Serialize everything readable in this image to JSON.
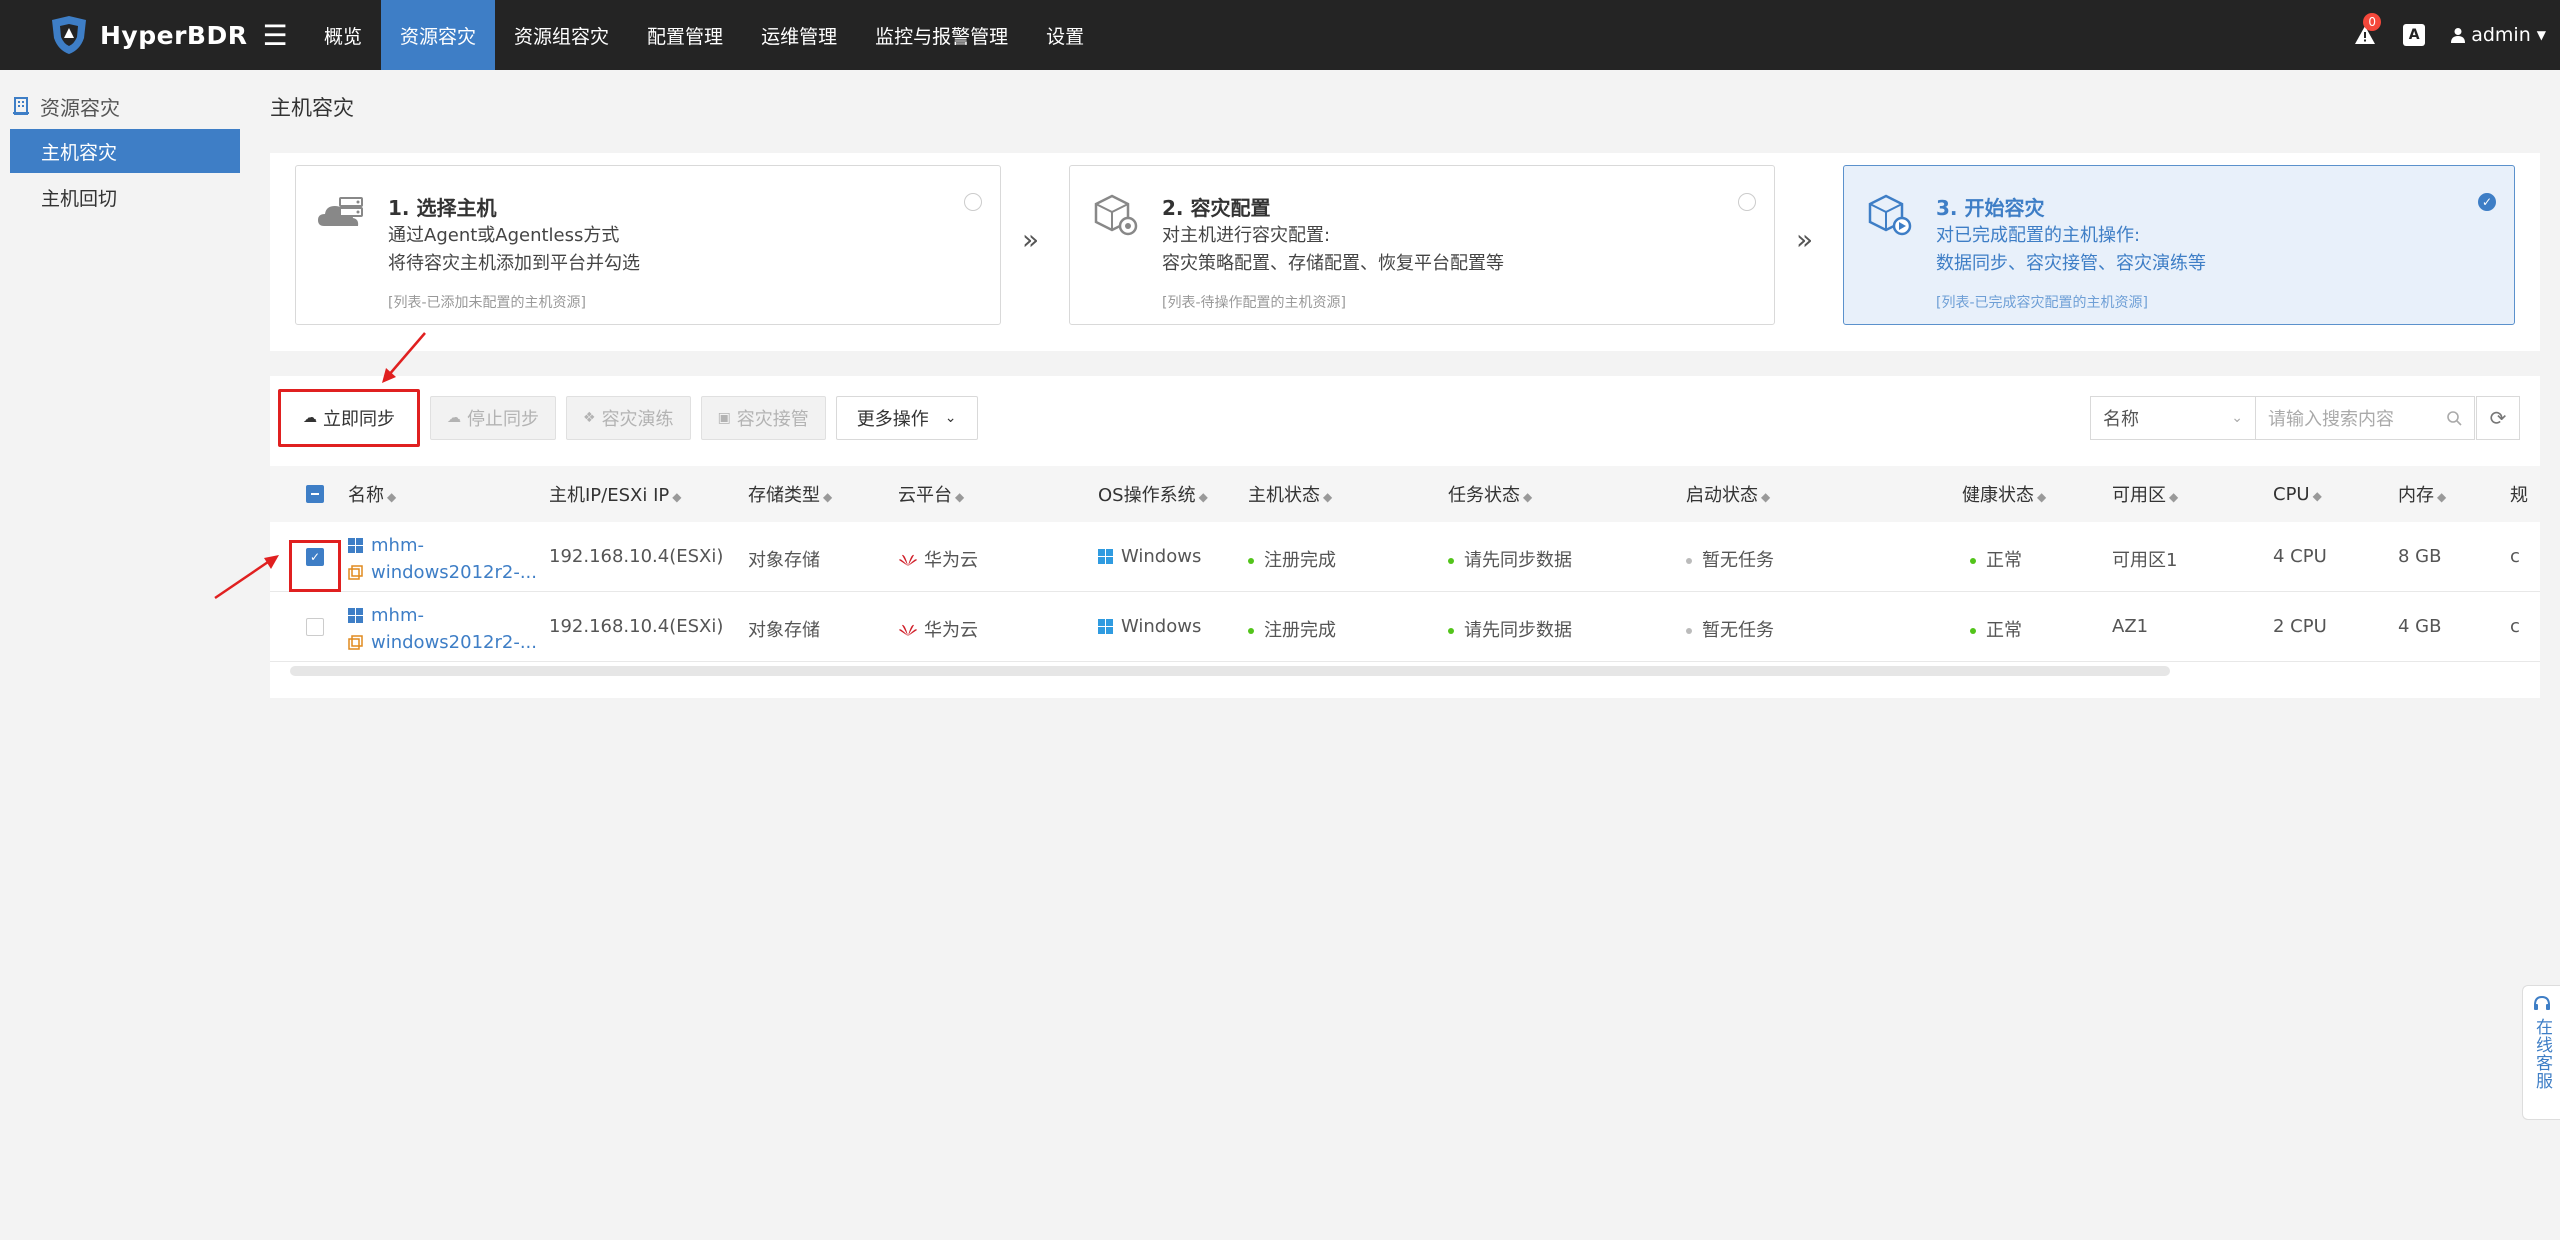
{
  "app": {
    "name": "HyperBDR"
  },
  "nav": {
    "items": [
      {
        "label": "概览",
        "active": false
      },
      {
        "label": "资源容灾",
        "active": true
      },
      {
        "label": "资源组容灾",
        "active": false
      },
      {
        "label": "配置管理",
        "active": false
      },
      {
        "label": "运维管理",
        "active": false
      },
      {
        "label": "监控与报警管理",
        "active": false
      },
      {
        "label": "设置",
        "active": false
      }
    ],
    "alert_count": "0",
    "lang_icon": "A",
    "user": "admin"
  },
  "sidebar": {
    "title": "资源容灾",
    "items": [
      {
        "label": "主机容灾",
        "active": true
      },
      {
        "label": "主机回切",
        "active": false
      }
    ]
  },
  "page": {
    "title": "主机容灾"
  },
  "steps": [
    {
      "title": "1. 选择主机",
      "desc1": "通过Agent或Agentless方式",
      "desc2": "将待容灾主机添加到平台并勾选",
      "note": "[列表-已添加未配置的主机资源]",
      "active": false
    },
    {
      "title": "2. 容灾配置",
      "desc1": "对主机进行容灾配置:",
      "desc2": "容灾策略配置、存储配置、恢复平台配置等",
      "note": "[列表-待操作配置的主机资源]",
      "active": false
    },
    {
      "title": "3. 开始容灾",
      "desc1": "对已完成配置的主机操作:",
      "desc2": "数据同步、容灾接管、容灾演练等",
      "note": "[列表-已完成容灾配置的主机资源]",
      "active": true
    }
  ],
  "toolbar": {
    "sync_now": "立即同步",
    "stop_sync": "停止同步",
    "dr_drill": "容灾演练",
    "dr_takeover": "容灾接管",
    "more": "更多操作"
  },
  "search": {
    "field": "名称",
    "placeholder": "请输入搜索内容"
  },
  "table": {
    "columns": [
      "名称",
      "主机IP/ESXi IP",
      "存储类型",
      "云平台",
      "OS操作系统",
      "主机状态",
      "任务状态",
      "启动状态",
      "健康状态",
      "可用区",
      "CPU",
      "内存",
      "规"
    ],
    "rows": [
      {
        "checked": true,
        "name1": "mhm-",
        "name2": "windows2012r2-...",
        "ip": "192.168.10.4(ESXi)",
        "storage": "对象存储",
        "cloud": "华为云",
        "os": "Windows",
        "host_status": "注册完成",
        "task_status": "请先同步数据",
        "boot_status": "暂无任务",
        "health": "正常",
        "zone": "可用区1",
        "cpu": "4 CPU",
        "mem": "8 GB",
        "extra": "c"
      },
      {
        "checked": false,
        "name1": "mhm-",
        "name2": "windows2012r2-...",
        "ip": "192.168.10.4(ESXi)",
        "storage": "对象存储",
        "cloud": "华为云",
        "os": "Windows",
        "host_status": "注册完成",
        "task_status": "请先同步数据",
        "boot_status": "暂无任务",
        "health": "正常",
        "zone": "AZ1",
        "cpu": "2 CPU",
        "mem": "4 GB",
        "extra": "c"
      }
    ]
  },
  "float_service": {
    "label": "在线客服"
  },
  "colors": {
    "accent": "#3e7ec6",
    "nav_bg": "#242424",
    "annotation": "#e02020",
    "ok": "#52c41a"
  }
}
